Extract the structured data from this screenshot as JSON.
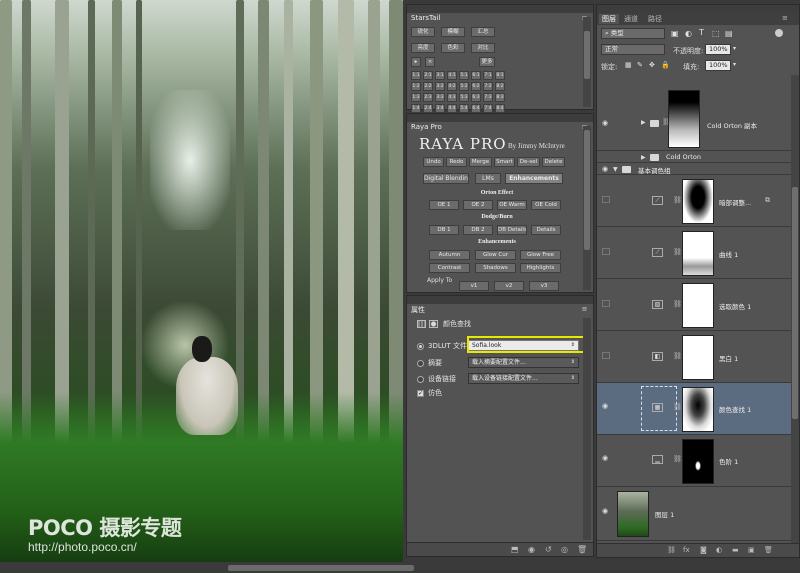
{
  "watermark": {
    "brand": "POCO 摄影专题",
    "url": "http://photo.poco.cn/"
  },
  "starstail": {
    "title": "StarsTail",
    "row1": [
      "锐化",
      "模糊",
      "汇总"
    ],
    "row2": [
      "亮度",
      "色彩",
      "对比"
    ],
    "more": "更多",
    "grid": [
      "1:1",
      "2:1",
      "3:1",
      "4:1",
      "5:1",
      "6:1",
      "7:1",
      "8:1",
      "1:2",
      "2:2",
      "3:2",
      "4:2",
      "5:2",
      "6:2",
      "7:2",
      "8:2",
      "1:3",
      "2:3",
      "3:3",
      "4:3",
      "5:3",
      "6:3",
      "7:3",
      "8:3",
      "1:4",
      "2:4",
      "3:4",
      "4:4",
      "5:4",
      "6:4",
      "7:4",
      "8:4"
    ]
  },
  "raya": {
    "title": "Raya Pro",
    "logo": "RAYA PRO",
    "byline": "By Jimmy McIntyre",
    "actions": [
      "Undo",
      "Redo",
      "Merge",
      "Smart",
      "De-sel",
      "Delete"
    ],
    "tabs": [
      "Digital Blending",
      "LMs",
      "Enhancements"
    ],
    "orton_label": "Orton Effect",
    "orton": [
      "OE 1",
      "OE 2",
      "OE Warm",
      "OE Cold"
    ],
    "dodge_label": "Dodge/Burn",
    "dodge": [
      "DB 1",
      "DB 2",
      "DB Details",
      "Details"
    ],
    "enh_label": "Enhancements",
    "enh1": [
      "Autumn",
      "Glow Cur",
      "Glow Free"
    ],
    "enh2": [
      "Contrast",
      "Shadows",
      "Highlights"
    ],
    "apply_to": "Apply To",
    "apply_opts": [
      "v1",
      "v2",
      "v3"
    ]
  },
  "properties": {
    "tab": "属性",
    "heading": "颜色查找",
    "opt1_label": "3DLUT 文件",
    "opt1_value": "Sofia.look",
    "opt2_label": "摘要",
    "opt2_value": "载入摘要配置文件...",
    "opt3_label": "设备链接",
    "opt3_value": "载入设备链接配置文件...",
    "dither_label": "仿色"
  },
  "layers": {
    "tabs": [
      "图层",
      "通道",
      "路径"
    ],
    "filter_kind": "类型",
    "blend_mode": "正常",
    "opacity_label": "不透明度:",
    "opacity_value": "100%",
    "lock_label": "锁定:",
    "fill_label": "填充:",
    "fill_value": "100%",
    "items": [
      {
        "name": "Cold Orton 副本"
      },
      {
        "name": "Cold Orton"
      },
      {
        "name": "基本调色组"
      },
      {
        "name": "暗部调整..."
      },
      {
        "name": "曲线 1"
      },
      {
        "name": "选取颜色 1"
      },
      {
        "name": "黑白 1"
      },
      {
        "name": "颜色查找 1"
      },
      {
        "name": "色阶 1"
      },
      {
        "name": "图层 1"
      }
    ]
  }
}
